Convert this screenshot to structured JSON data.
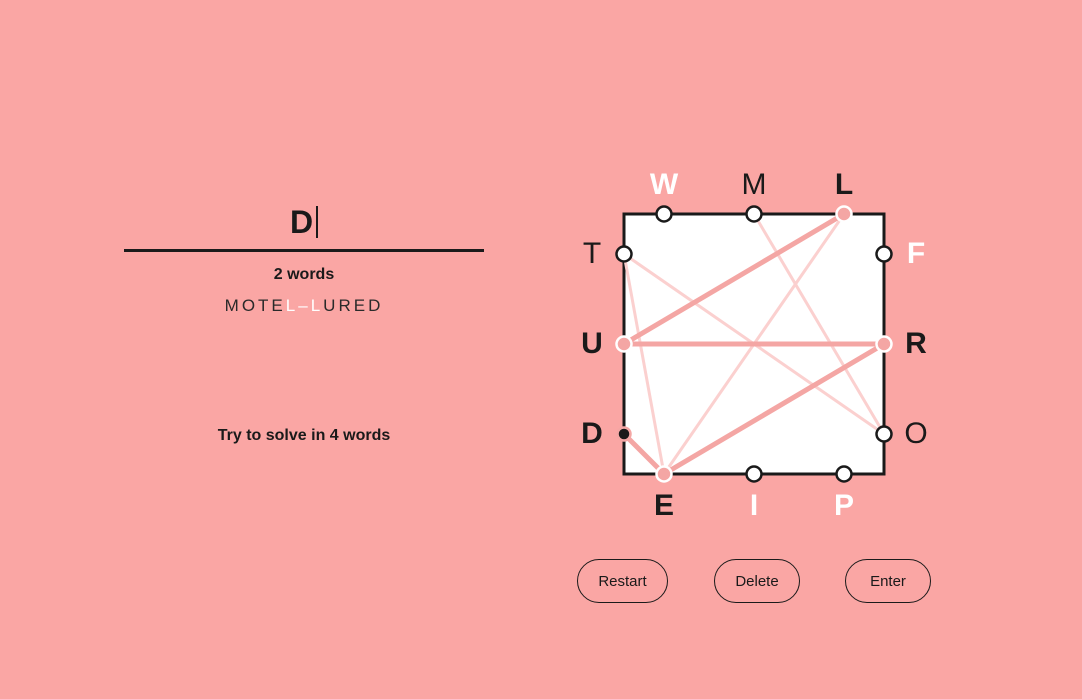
{
  "input": {
    "current_word": "D"
  },
  "progress": {
    "word_count_label": "2 words",
    "words_display": [
      {
        "text": "MOTE",
        "style": "normal"
      },
      {
        "text": "L",
        "style": "shared"
      },
      {
        "text": "–",
        "style": "dash"
      },
      {
        "text": "L",
        "style": "shared"
      },
      {
        "text": "URED",
        "style": "normal"
      }
    ]
  },
  "hint": "Try to solve in 4 words",
  "board": {
    "letters": {
      "top": [
        "W",
        "M",
        "L"
      ],
      "left": [
        "T",
        "U",
        "D"
      ],
      "right": [
        "F",
        "R",
        "O"
      ],
      "bottom": [
        "E",
        "I",
        "P"
      ]
    },
    "letter_states": {
      "W": "done",
      "M": "normal",
      "L": "used",
      "T": "normal",
      "U": "used",
      "D": "current",
      "F": "done",
      "R": "used",
      "O": "normal",
      "E": "used",
      "I": "done",
      "P": "done"
    },
    "colors": {
      "board_fill": "#ffffff",
      "board_stroke": "#1a1a1a",
      "completed_path": "#fbd0cf",
      "current_path": "#f4a6a4",
      "background": "#faa6a4"
    }
  },
  "buttons": {
    "restart": "Restart",
    "delete": "Delete",
    "enter": "Enter"
  }
}
